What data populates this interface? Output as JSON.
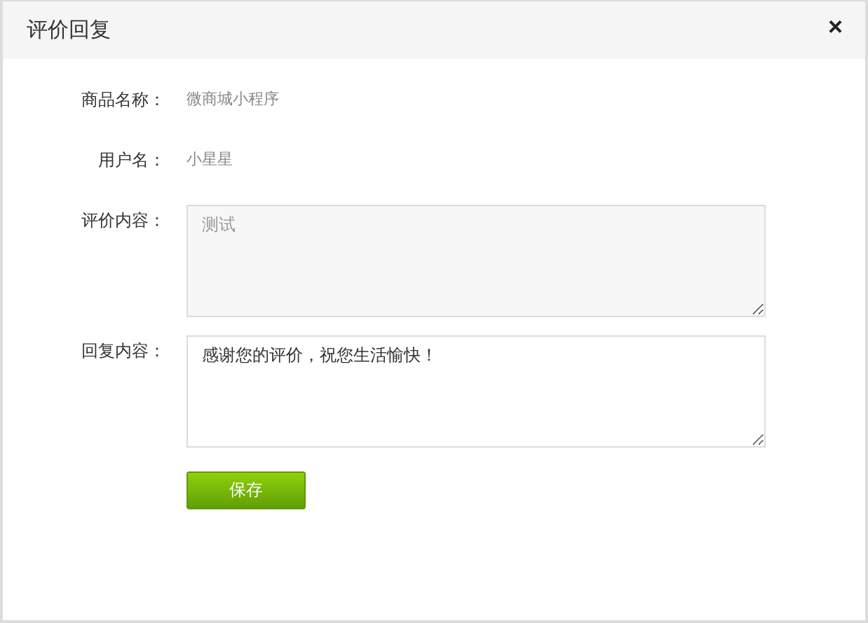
{
  "dialog": {
    "title": "评价回复",
    "close": "×"
  },
  "fields": [
    {
      "kind": "text",
      "label": "商品名称：",
      "value": "微商城小程序"
    },
    {
      "kind": "text",
      "label": "用户名：",
      "value": "小星星"
    },
    {
      "kind": "textarea",
      "label": "评价内容：",
      "value": "测试",
      "disabled": true
    },
    {
      "kind": "textarea",
      "label": "回复内容：",
      "value": "感谢您的评价，祝您生活愉快！",
      "disabled": false
    }
  ],
  "buttons": [
    "保存"
  ]
}
